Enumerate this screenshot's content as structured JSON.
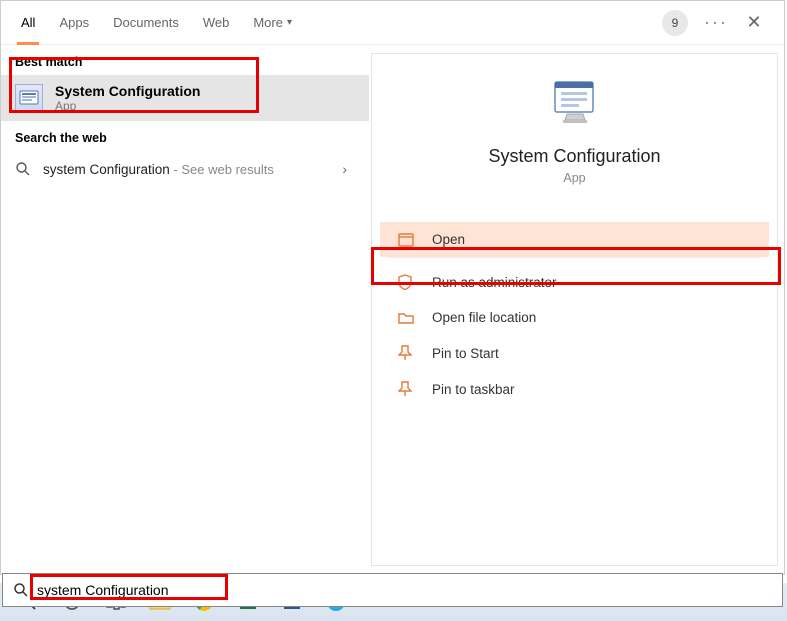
{
  "tabs": {
    "all": "All",
    "apps": "Apps",
    "documents": "Documents",
    "web": "Web",
    "more": "More"
  },
  "header": {
    "badge": "9"
  },
  "left": {
    "best_match_label": "Best match",
    "result": {
      "title": "System Configuration",
      "subtitle": "App"
    },
    "search_web_label": "Search the web",
    "web_query": "system Configuration",
    "web_suffix": " - See web results"
  },
  "preview": {
    "title": "System Configuration",
    "subtitle": "App",
    "actions": {
      "open": "Open",
      "run_admin": "Run as administrator",
      "open_loc": "Open file location",
      "pin_start": "Pin to Start",
      "pin_taskbar": "Pin to taskbar"
    }
  },
  "search_input": {
    "value": "system Configuration"
  }
}
